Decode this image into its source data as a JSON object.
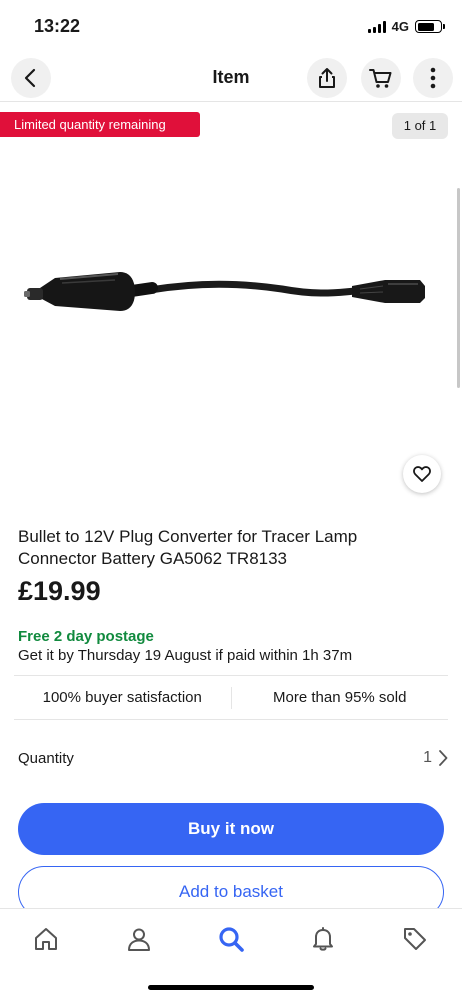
{
  "status_bar": {
    "time": "13:22",
    "network": "4G"
  },
  "nav": {
    "title": "Item",
    "back_icon": "chevron-left-icon",
    "share_icon": "share-icon",
    "cart_icon": "cart-icon",
    "more_icon": "more-vertical-icon"
  },
  "badges": {
    "limited": "Limited quantity remaining",
    "page_counter": "1 of 1"
  },
  "product": {
    "title": "Bullet to 12V Plug Converter for Tracer Lamp Connector Battery GA5062 TR8133",
    "price": "£19.99",
    "postage": "Free 2 day postage",
    "delivery": "Get it by Thursday 19 August if paid within 1h 37m"
  },
  "stats": {
    "satisfaction": "100% buyer satisfaction",
    "sold": "More than 95% sold"
  },
  "quantity": {
    "label": "Quantity",
    "value": "1"
  },
  "actions": {
    "buy_now": "Buy it now",
    "add_to_basket": "Add to basket"
  },
  "tabs": [
    {
      "icon": "home-icon"
    },
    {
      "icon": "profile-icon"
    },
    {
      "icon": "search-icon",
      "active": true
    },
    {
      "icon": "bell-icon"
    },
    {
      "icon": "tag-icon"
    }
  ],
  "colors": {
    "accent": "#3665f3",
    "badge_red": "#e0103a",
    "postage_green": "#118a3e",
    "text": "#191919"
  }
}
